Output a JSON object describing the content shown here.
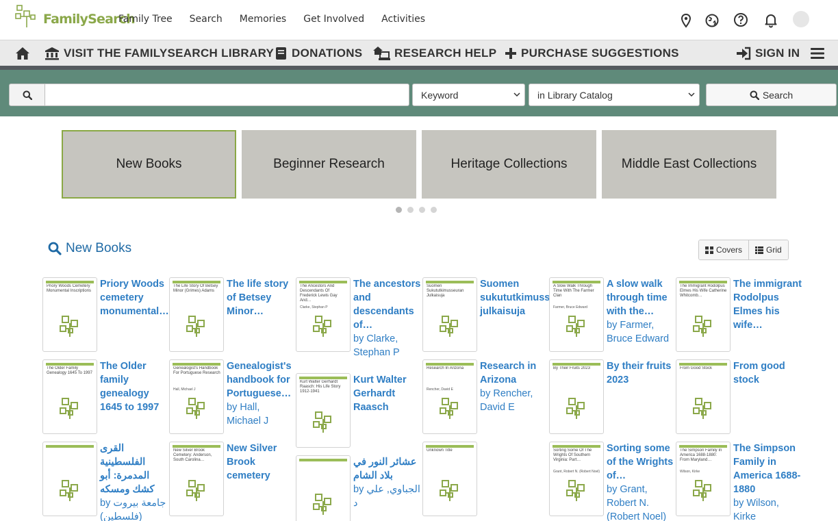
{
  "header": {
    "logo_text": "FamilySearch",
    "nav": [
      "Family Tree",
      "Search",
      "Memories",
      "Get Involved",
      "Activities"
    ],
    "icons": [
      "location-icon",
      "globe-icon",
      "help-icon",
      "bell-icon"
    ]
  },
  "library_bar": {
    "visit": "VISIT THE FAMILYSEARCH LIBRARY",
    "donations": "DONATIONS",
    "research_help": "RESEARCH HELP",
    "purchase": "PURCHASE SUGGESTIONS",
    "sign_in": "SIGN IN"
  },
  "search": {
    "placeholder": "",
    "type_selected": "Keyword",
    "scope_selected": "in Library Catalog",
    "button_label": "Search"
  },
  "carousel": {
    "slides": [
      "New Books",
      "Beginner Research",
      "Heritage Collections",
      "Middle East Collections"
    ],
    "active_index": 0
  },
  "section": {
    "title": "New Books",
    "view_covers": "Covers",
    "view_grid": "Grid"
  },
  "books": [
    {
      "title": "Priory Woods cemetery monumental…",
      "author": "",
      "cover_title": "Priory Woods Cemetery Monumental Inscriptions",
      "cover_author": ""
    },
    {
      "title": "The life story of Betsey Minor…",
      "author": "",
      "cover_title": "The Life Story Of Betsey Minor (Grimes) Adams",
      "cover_author": ""
    },
    {
      "title": "The ancestors and descendants of…",
      "author": "by Clarke, Stephan P",
      "cover_title": "The Ancestors And Descendants Of Frederick Lewis Gay And…",
      "cover_author": "Clarke, Stephan P"
    },
    {
      "title": "Suomen sukututkimusseuran julkaisuja",
      "author": "",
      "cover_title": "Suomen Sukututkimusseuran Julkaisuja",
      "cover_author": ""
    },
    {
      "title": "A slow walk through time with the…",
      "author": "by Farmer, Bruce Edward",
      "cover_title": "A Slow Walk Through Time With The Farmer Clan",
      "cover_author": "Farmer, Bruce Edward"
    },
    {
      "title": "The immigrant Rodolpus Elmes his wife…",
      "author": "",
      "cover_title": "The Immigrant Rodolpus Elmes His Wife Catherine Whitcomb…",
      "cover_author": ""
    },
    {
      "title": "The Older family genealogy 1645 to 1997",
      "author": "",
      "cover_title": "The Older Family Genealogy 1645 To 1997",
      "cover_author": ""
    },
    {
      "title": "Genealogist's handbook for Portuguese…",
      "author": "by Hall, Michael J",
      "cover_title": "Genealogist's Handbook For Portuguese Research",
      "cover_author": "Hall, Michael J"
    },
    {
      "title": "Kurt Walter Gerhardt Raasch",
      "author": "",
      "cover_title": "Kurt Walter Gerhardt Raasch: His Life Story 1912-1941",
      "cover_author": ""
    },
    {
      "title": "Research in Arizona",
      "author": "by Rencher, David E",
      "cover_title": "Research In Arizona",
      "cover_author": "Rencher, David E"
    },
    {
      "title": "By their fruits 2023",
      "author": "",
      "cover_title": "By Their Fruits 2023",
      "cover_author": ""
    },
    {
      "title": "From good stock",
      "author": "",
      "cover_title": "From Good Stock",
      "cover_author": ""
    },
    {
      "title": "القرى الفلسطينية المدمرة: أبو كشك ومسكه",
      "author": "by جامعة بيروت (فلسطين)",
      "cover_title": "",
      "cover_author": ""
    },
    {
      "title": "New Silver Brook cemetery",
      "author": "",
      "cover_title": "New Silver Brook Cemetery: Anderson, South Carolina…",
      "cover_author": ""
    },
    {
      "title": "عشائر النور في بلاد الشام",
      "author": "by الجباوي, علي د",
      "cover_title": "",
      "cover_author": ""
    },
    {
      "title": "",
      "author": "",
      "cover_title": "Unknown Title",
      "cover_author": ""
    },
    {
      "title": "Sorting some of the Wrights of…",
      "author": "by Grant, Robert N. (Robert Noel)",
      "cover_title": "Sorting Some Of The Wrights Of Southern Virginia: Part…",
      "cover_author": "Grant, Robert N. (Robert Noel)"
    },
    {
      "title": "The Simpson Family in America 1688-1880",
      "author": "by Wilson, Kirke",
      "cover_title": "The Simpson Family In America 1688-1880: From Maryland…",
      "cover_author": "Wilson, Kirke"
    }
  ]
}
